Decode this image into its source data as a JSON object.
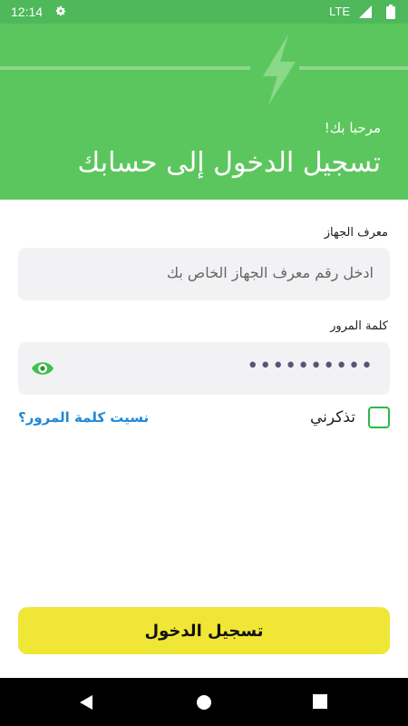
{
  "status_bar": {
    "time": "12:14",
    "network": "LTE",
    "icons": [
      "gear-icon",
      "signal-icon",
      "battery-icon"
    ]
  },
  "header": {
    "welcome": "مرحبا بك!",
    "title": "تسجيل الدخول إلى حسابك",
    "icon": "lightning-bolt-icon"
  },
  "form": {
    "device_id": {
      "label": "معرف الجهاز",
      "placeholder": "ادخل رقم معرف الجهاز الخاص بك"
    },
    "password": {
      "label": "كلمة المرور",
      "masked_value": "••••••••••",
      "toggle_icon": "eye-icon"
    },
    "remember_me": {
      "label": "تذكرني",
      "checked": false
    },
    "forgot_password": "نسيت كلمة المرور؟"
  },
  "login_button": {
    "label": "تسجيل الدخول"
  },
  "colors": {
    "header_green": "#5cc65e",
    "accent_yellow": "#f0e636",
    "link_blue": "#1f88d8",
    "checkbox_green": "#2db84b"
  },
  "nav_bar": {
    "icons": [
      "back-icon",
      "home-icon",
      "recents-icon"
    ]
  }
}
